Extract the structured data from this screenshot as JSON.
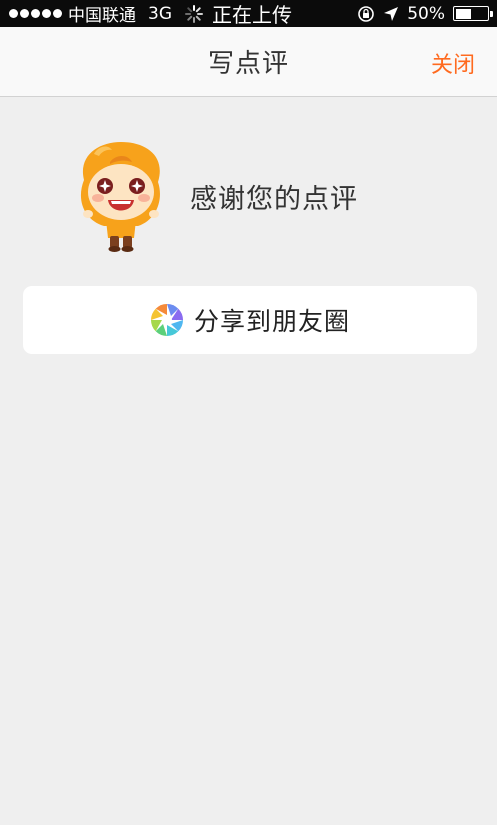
{
  "status_bar": {
    "carrier": "中国联通",
    "network": "3G",
    "activity": "正在上传",
    "battery_percent": "50%",
    "battery_level": 0.5,
    "icons": [
      "signal-icon",
      "activity-spinner-icon",
      "rotation-lock-icon",
      "location-arrow-icon",
      "battery-icon"
    ]
  },
  "nav": {
    "title": "写点评",
    "close_label": "关闭"
  },
  "thanks": {
    "text": "感谢您的点评",
    "mascot_icon": "mascot-character"
  },
  "share": {
    "label": "分享到朋友圈",
    "icon": "moments-icon"
  },
  "colors": {
    "accent": "#ff6a1f",
    "background": "#efefef",
    "status_bar": "#0b0b0b",
    "mascot_orange": "#f7a21b"
  }
}
